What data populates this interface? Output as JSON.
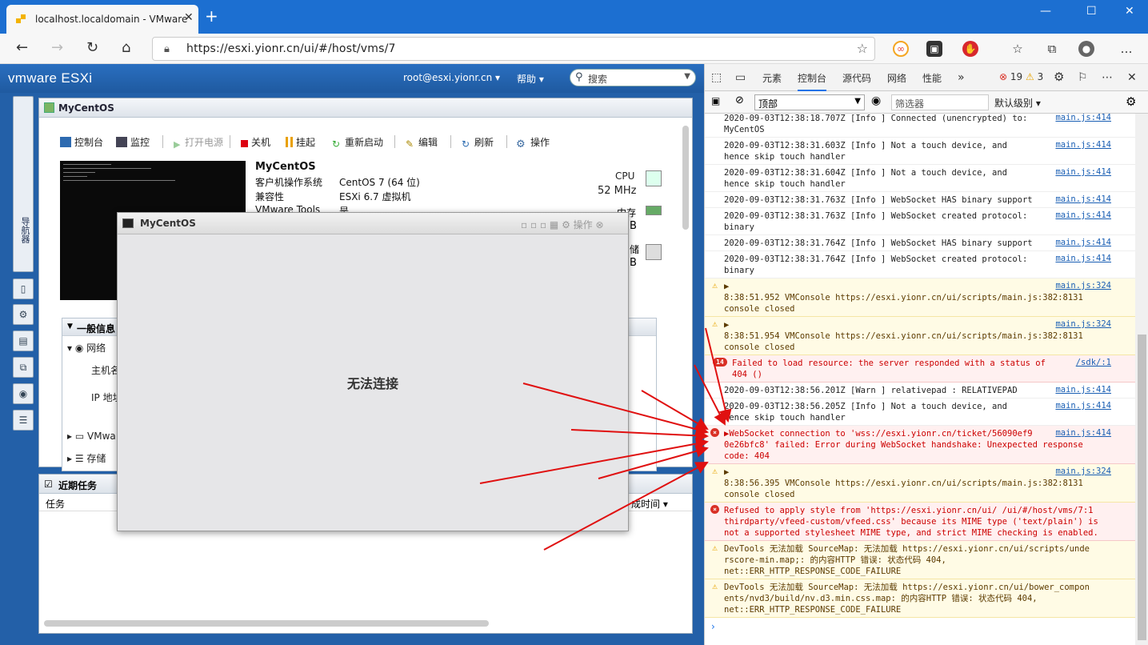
{
  "browser": {
    "tab_title": "localhost.localdomain - VMware",
    "url": "https://esxi.yionr.cn/ui/#/host/vms/7"
  },
  "esxi": {
    "logo_vm": "vm",
    "logo_ware": "ware",
    "logo_esxi": "ESXi",
    "user": "root@esxi.yionr.cn ▾",
    "help": "帮助 ▾",
    "search_placeholder": "搜索",
    "navigator_label": "导航器",
    "vm_panel_title": "MyCentOS",
    "toolbar": {
      "console": "控制台",
      "monitor": "监控",
      "power_on": "打开电源",
      "shutdown": "关机",
      "suspend": "挂起",
      "restart": "重新启动",
      "edit": "编辑",
      "refresh": "刷新",
      "actions": "操作"
    },
    "vm_name": "MyCentOS",
    "props": [
      {
        "label": "客户机操作系统",
        "value": "CentOS 7 (64 位)"
      },
      {
        "label": "兼容性",
        "value": "ESXi 6.7 虚拟机"
      },
      {
        "label": "VMware Tools",
        "value": "是"
      }
    ],
    "cpu_label": "CPU",
    "cpu_value": "52 MHz",
    "mem_label": "内存",
    "mem_unit": "B",
    "storage_label": "储",
    "storage_unit": "B",
    "general_info": "一般信息",
    "network": "网络",
    "hostname": "主机名",
    "ip": "IP 地址",
    "vmware_row": "VMwa",
    "storage_row": "存储",
    "recent_tasks": "近期任务",
    "task_col": "任务",
    "complete_col": "成时间 ▾"
  },
  "console_dialog": {
    "title": "MyCentOS",
    "actions": "操作",
    "message": "无法连接"
  },
  "devtools": {
    "tabs": [
      "元素",
      "控制台",
      "源代码",
      "网络",
      "性能"
    ],
    "more": "»",
    "error_count": "19",
    "warn_count": "3",
    "context": "顶部",
    "filter_placeholder": "筛选器",
    "level": "默认级别 ▾",
    "logs": [
      {
        "type": "info",
        "lines": [
          "2020-09-03T12:38:18.707Z [Info ] Connected (unencrypted) to:",
          "MyCentOS"
        ],
        "src": "main.js:414"
      },
      {
        "type": "info",
        "lines": [
          "2020-09-03T12:38:31.603Z [Info ] Not a touch device, and",
          "hence skip touch handler"
        ],
        "src": "main.js:414"
      },
      {
        "type": "info",
        "lines": [
          "2020-09-03T12:38:31.604Z [Info ] Not a touch device, and",
          "hence skip touch handler"
        ],
        "src": "main.js:414"
      },
      {
        "type": "info",
        "lines": [
          "2020-09-03T12:38:31.763Z [Info ] WebSocket HAS binary support"
        ],
        "src": "main.js:414"
      },
      {
        "type": "info",
        "lines": [
          "2020-09-03T12:38:31.763Z [Info ] WebSocket created protocol:",
          "binary"
        ],
        "src": "main.js:414"
      },
      {
        "type": "info",
        "lines": [
          "2020-09-03T12:38:31.764Z [Info ] WebSocket HAS binary support"
        ],
        "src": "main.js:414"
      },
      {
        "type": "info",
        "lines": [
          "2020-09-03T12:38:31.764Z [Info ] WebSocket created protocol:",
          "binary"
        ],
        "src": "main.js:414"
      },
      {
        "type": "warn",
        "lines": [
          "▶",
          "8:38:51.952 VMConsole https://esxi.yionr.cn/ui/scripts/main.js:382:8131",
          "console closed"
        ],
        "src": "main.js:324"
      },
      {
        "type": "warn",
        "lines": [
          "▶",
          "8:38:51.954 VMConsole https://esxi.yionr.cn/ui/scripts/main.js:382:8131",
          "console closed"
        ],
        "src": "main.js:324"
      },
      {
        "type": "err",
        "badge": "14",
        "lines": [
          "Failed to load resource: the server responded with a status of",
          "404 ()"
        ],
        "src": "/sdk/:1"
      },
      {
        "type": "info",
        "lines": [
          "2020-09-03T12:38:56.201Z [Warn ] relativepad : RELATIVEPAD"
        ],
        "src": "main.js:414"
      },
      {
        "type": "info",
        "lines": [
          "2020-09-03T12:38:56.205Z [Info ] Not a touch device, and",
          "hence skip touch handler"
        ],
        "src": "main.js:414"
      },
      {
        "type": "err",
        "lines": [
          "▶WebSocket connection to 'wss://esxi.yionr.cn/ticket/56090ef9",
          "0e26bfc8' failed: Error during WebSocket handshake: Unexpected response",
          "code: 404"
        ],
        "src": "main.js:414"
      },
      {
        "type": "warn",
        "lines": [
          "▶",
          "8:38:56.395 VMConsole https://esxi.yionr.cn/ui/scripts/main.js:382:8131",
          "console closed"
        ],
        "src": "main.js:324"
      },
      {
        "type": "err",
        "lines": [
          "Refused to apply style from 'https://esxi.yionr.cn/ui/ /ui/#/host/vms/7:1",
          "thirdparty/vfeed-custom/vfeed.css' because its MIME type ('text/plain') is",
          "not a supported stylesheet MIME type, and strict MIME checking is enabled."
        ],
        "src": ""
      },
      {
        "type": "warn",
        "lines": [
          "DevTools 无法加载 SourceMap: 无法加载 https://esxi.yionr.cn/ui/scripts/unde",
          "rscore-min.map;: 的内容HTTP 错误: 状态代码 404,",
          "net::ERR_HTTP_RESPONSE_CODE_FAILURE"
        ],
        "src": ""
      },
      {
        "type": "warn",
        "lines": [
          "DevTools 无法加载 SourceMap: 无法加载 https://esxi.yionr.cn/ui/bower_compon",
          "ents/nvd3/build/nv.d3.min.css.map: 的内容HTTP 错误: 状态代码 404,",
          "net::ERR_HTTP_RESPONSE_CODE_FAILURE"
        ],
        "src": ""
      }
    ],
    "prompt": "›"
  }
}
